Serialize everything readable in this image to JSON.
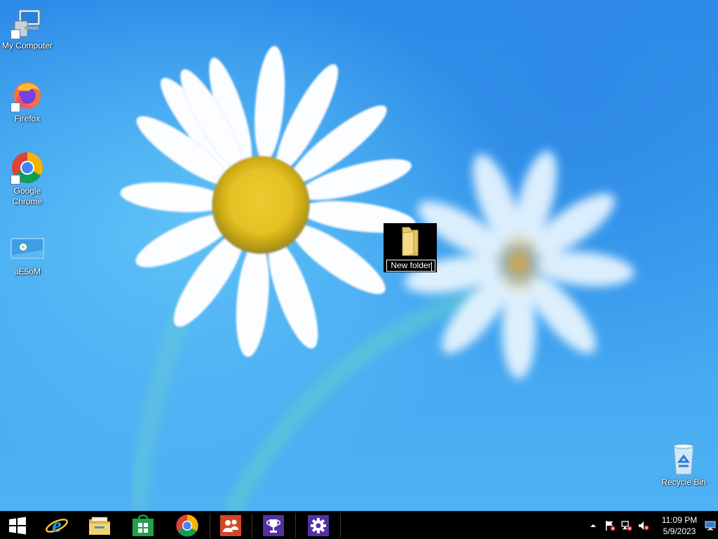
{
  "desktop": {
    "icons": [
      {
        "label": "My Computer",
        "icon": "computer-icon"
      },
      {
        "label": "Firefox",
        "icon": "firefox-icon"
      },
      {
        "label": "Google Chrome",
        "icon": "chrome-icon"
      },
      {
        "label": "aE5oM",
        "icon": "image-thumbnail-icon"
      },
      {
        "label": "Recycle Bin",
        "icon": "recycle-bin-icon"
      }
    ],
    "selected_item": {
      "label": "New folder",
      "icon": "folder-icon",
      "state": "renaming"
    }
  },
  "taskbar": {
    "pinned": [
      {
        "name": "Start",
        "icon": "windows-start-icon"
      },
      {
        "name": "Internet Explorer",
        "icon": "internet-explorer-icon"
      },
      {
        "name": "File Explorer",
        "icon": "file-explorer-icon"
      },
      {
        "name": "Store",
        "icon": "store-icon"
      },
      {
        "name": "Google Chrome",
        "icon": "chrome-icon"
      },
      {
        "name": "People",
        "icon": "people-icon"
      },
      {
        "name": "Trophy",
        "icon": "trophy-icon"
      },
      {
        "name": "Settings",
        "icon": "settings-gear-icon"
      }
    ],
    "tray": {
      "icons": [
        "show-hidden-icons-icon",
        "action-center-flag-icon",
        "network-disconnected-icon",
        "volume-muted-icon"
      ],
      "time": "11:09 PM",
      "date": "5/9/2023"
    }
  },
  "colors": {
    "taskbar": "#000000",
    "wallpaper_blue": "#3a9cef",
    "tile_purple": "#5530a3",
    "store_green": "#22a04b",
    "people_red": "#d24726"
  }
}
